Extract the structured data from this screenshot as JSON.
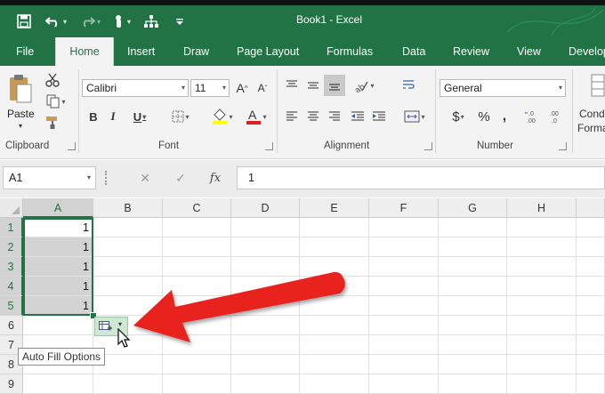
{
  "window": {
    "title": "Book1  -  Excel"
  },
  "tabs": [
    "File",
    "Home",
    "Insert",
    "Draw",
    "Page Layout",
    "Formulas",
    "Data",
    "Review",
    "View",
    "Develop"
  ],
  "active_tab": "Home",
  "ribbon": {
    "clipboard": {
      "label": "Clipboard",
      "paste_label": "Paste"
    },
    "font": {
      "label": "Font",
      "font_name": "Calibri",
      "font_size": "11"
    },
    "alignment": {
      "label": "Alignment"
    },
    "number": {
      "label": "Number",
      "format": "General",
      "currency_symbol": "$",
      "percent_symbol": "%",
      "comma_symbol": ","
    },
    "styles": {
      "label_line1": "Cond",
      "label_line2": "Forma"
    }
  },
  "formula_bar": {
    "name_box": "A1",
    "fx_label": "fx",
    "value": "1"
  },
  "grid": {
    "columns": [
      "A",
      "B",
      "C",
      "D",
      "E",
      "F",
      "G",
      "H"
    ],
    "rows": [
      "1",
      "2",
      "3",
      "4",
      "5",
      "6",
      "7",
      "8",
      "9"
    ],
    "cells_A": [
      "1",
      "1",
      "1",
      "1",
      "1"
    ]
  },
  "autofill": {
    "tooltip": "Auto Fill Options"
  },
  "colors": {
    "excel_green": "#217346",
    "arrow_red": "#e8221b"
  }
}
